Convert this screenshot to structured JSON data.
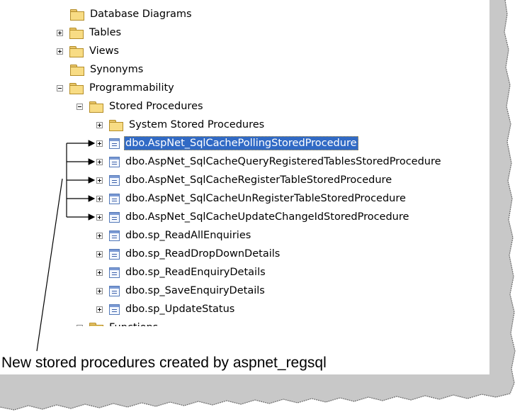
{
  "tree": {
    "items": [
      {
        "label": "Database Diagrams",
        "icon": "folder-icon",
        "expander": "none"
      },
      {
        "label": "Tables",
        "icon": "folder-icon",
        "expander": "plus"
      },
      {
        "label": "Views",
        "icon": "folder-icon",
        "expander": "plus"
      },
      {
        "label": "Synonyms",
        "icon": "folder-icon",
        "expander": "none"
      },
      {
        "label": "Programmability",
        "icon": "folder-icon",
        "expander": "minus"
      },
      {
        "label": "Stored Procedures",
        "icon": "folder-icon",
        "expander": "minus"
      },
      {
        "label": "System Stored Procedures",
        "icon": "folder-icon",
        "expander": "plus"
      },
      {
        "label": "dbo.AspNet_SqlCachePollingStoredProcedure",
        "icon": "stored-procedure-icon",
        "expander": "plus",
        "selected": true
      },
      {
        "label": "dbo.AspNet_SqlCacheQueryRegisteredTablesStoredProcedure",
        "icon": "stored-procedure-icon",
        "expander": "plus"
      },
      {
        "label": "dbo.AspNet_SqlCacheRegisterTableStoredProcedure",
        "icon": "stored-procedure-icon",
        "expander": "plus"
      },
      {
        "label": "dbo.AspNet_SqlCacheUnRegisterTableStoredProcedure",
        "icon": "stored-procedure-icon",
        "expander": "plus"
      },
      {
        "label": "dbo.AspNet_SqlCacheUpdateChangeIdStoredProcedure",
        "icon": "stored-procedure-icon",
        "expander": "plus"
      },
      {
        "label": "dbo.sp_ReadAllEnquiries",
        "icon": "stored-procedure-icon",
        "expander": "plus"
      },
      {
        "label": "dbo.sp_ReadDropDownDetails",
        "icon": "stored-procedure-icon",
        "expander": "plus"
      },
      {
        "label": "dbo.sp_ReadEnquiryDetails",
        "icon": "stored-procedure-icon",
        "expander": "plus"
      },
      {
        "label": "dbo.sp_SaveEnquiryDetails",
        "icon": "stored-procedure-icon",
        "expander": "plus"
      },
      {
        "label": "dbo.sp_UpdateStatus",
        "icon": "stored-procedure-icon",
        "expander": "plus"
      },
      {
        "label": "Functions",
        "icon": "folder-icon",
        "expander": "plus"
      }
    ]
  },
  "annotation": {
    "caption": "New stored procedures created by aspnet_regsql"
  },
  "colors": {
    "selection": "#316ac5",
    "background_torn": "#c8c8c8"
  }
}
